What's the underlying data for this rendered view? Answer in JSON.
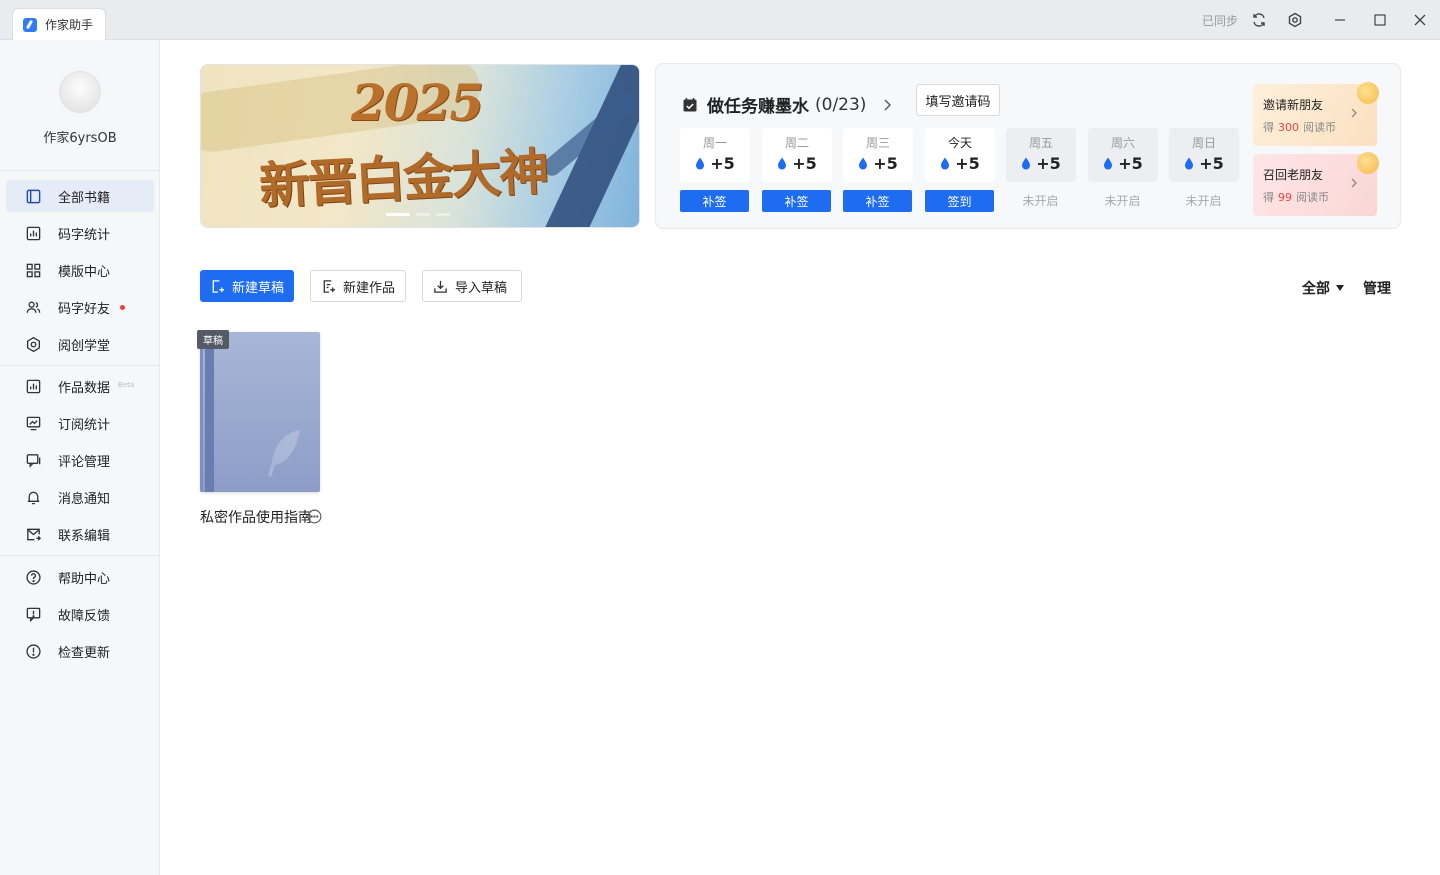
{
  "app": {
    "title": "作家助手",
    "sync_status": "已同步"
  },
  "user": {
    "name": "作家6yrsOB"
  },
  "sidebar": {
    "groups": [
      [
        {
          "label": "全部书籍",
          "icon": "book-icon",
          "active": true
        },
        {
          "label": "码字统计",
          "icon": "bar-chart-icon"
        },
        {
          "label": "模版中心",
          "icon": "grid-icon"
        },
        {
          "label": "码字好友",
          "icon": "users-icon",
          "dot": true
        },
        {
          "label": "阅创学堂",
          "icon": "hexagon-icon"
        }
      ],
      [
        {
          "label": "作品数据",
          "icon": "data-chart-icon",
          "badge": "Beta"
        },
        {
          "label": "订阅统计",
          "icon": "trend-chart-icon"
        },
        {
          "label": "评论管理",
          "icon": "comment-icon"
        },
        {
          "label": "消息通知",
          "icon": "bell-icon"
        },
        {
          "label": "联系编辑",
          "icon": "mail-icon"
        }
      ],
      [
        {
          "label": "帮助中心",
          "icon": "help-icon"
        },
        {
          "label": "故障反馈",
          "icon": "feedback-icon"
        },
        {
          "label": "检查更新",
          "icon": "update-icon"
        }
      ]
    ]
  },
  "banner": {
    "year": "2025",
    "slogan": "新晋白金大神"
  },
  "tasks": {
    "title": "做任务赚墨水",
    "progress": "(0/23)",
    "invite_code_button": "填写邀请码",
    "days": [
      {
        "name": "周一",
        "points": "+5",
        "action": "补签",
        "state": "open"
      },
      {
        "name": "周二",
        "points": "+5",
        "action": "补签",
        "state": "open"
      },
      {
        "name": "周三",
        "points": "+5",
        "action": "补签",
        "state": "open"
      },
      {
        "name": "今天",
        "points": "+5",
        "action": "签到",
        "state": "today"
      },
      {
        "name": "周五",
        "points": "+5",
        "action": "未开启",
        "state": "locked"
      },
      {
        "name": "周六",
        "points": "+5",
        "action": "未开启",
        "state": "locked"
      },
      {
        "name": "周日",
        "points": "+5",
        "action": "未开启",
        "state": "locked"
      }
    ],
    "promos": [
      {
        "title": "邀请新朋友",
        "prefix": "得",
        "amount": "300",
        "unit": "阅读币"
      },
      {
        "title": "召回老朋友",
        "prefix": "得",
        "amount": "99",
        "unit": "阅读币"
      }
    ]
  },
  "toolbar": {
    "new_draft": "新建草稿",
    "new_work": "新建作品",
    "import_draft": "导入草稿",
    "filter": "全部",
    "manage": "管理"
  },
  "books": [
    {
      "title": "私密作品使用指南",
      "tag": "草稿"
    }
  ],
  "colors": {
    "primary": "#1e6cf0",
    "sidebar_bg": "#f6f7f9",
    "active_bg": "#e6ecf7"
  }
}
